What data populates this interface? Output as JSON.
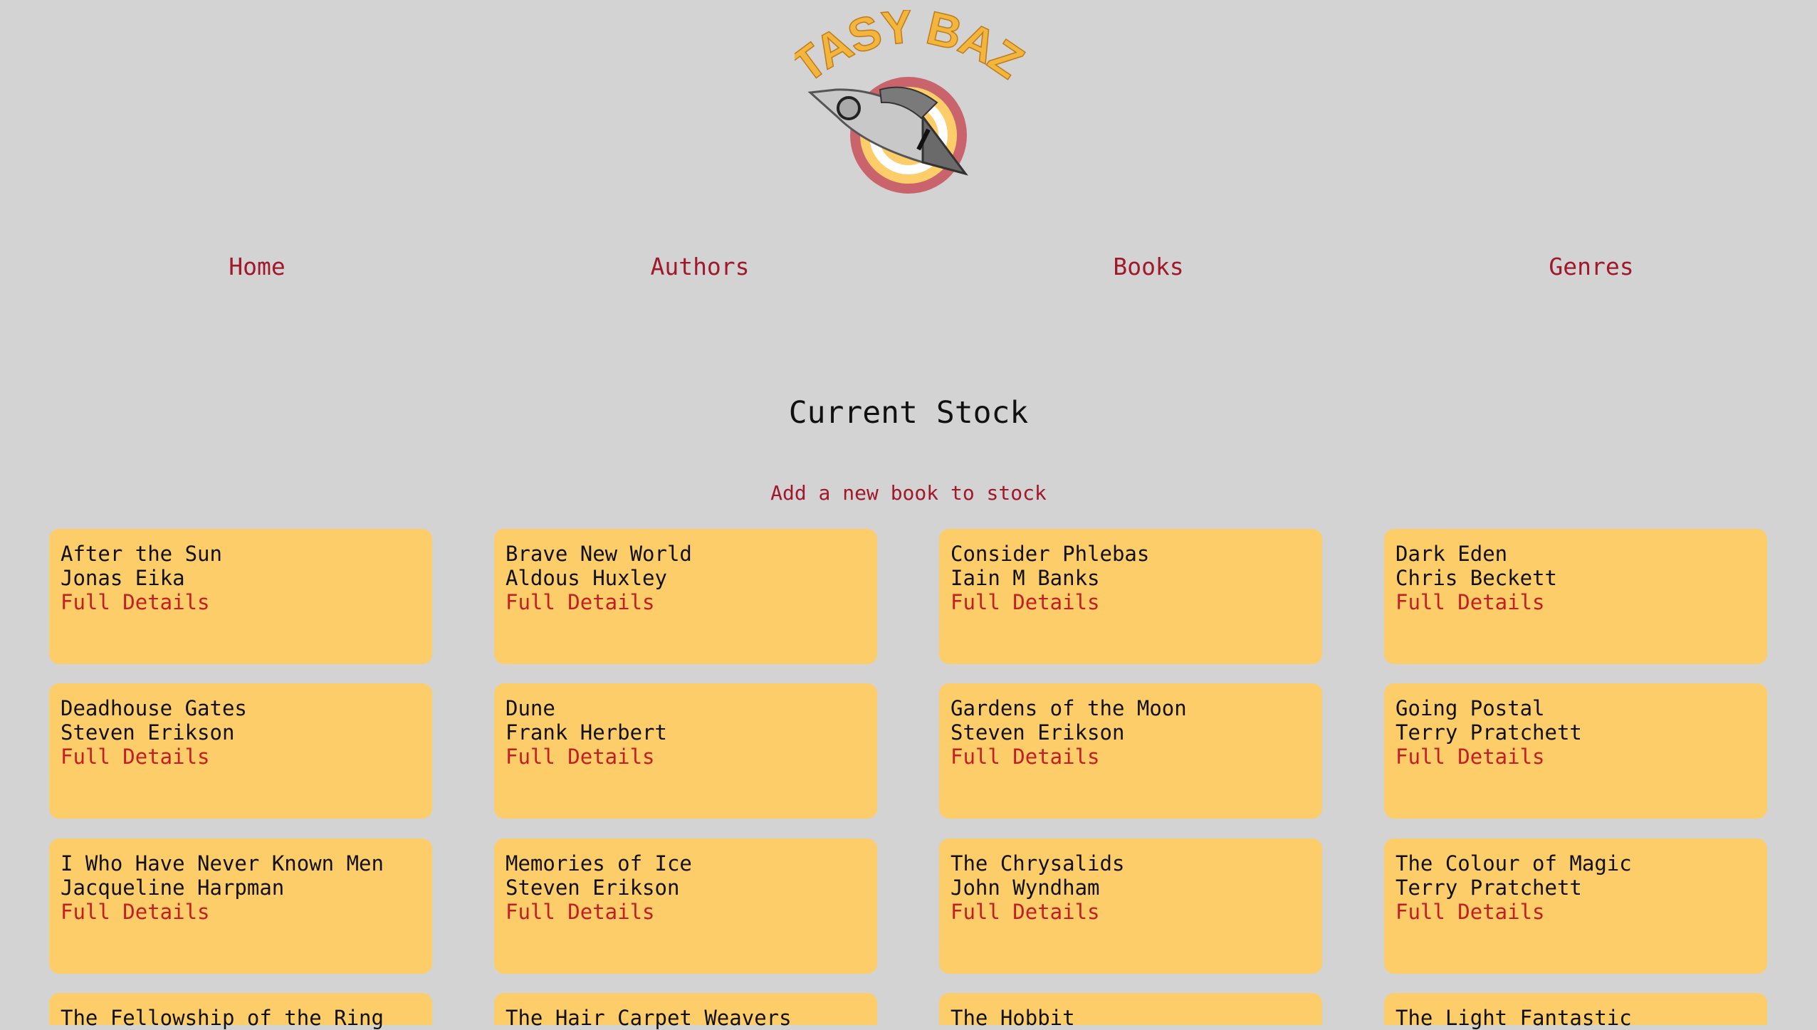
{
  "brand": {
    "logo_text": "FANTASY BAZAAR",
    "colors": {
      "logo_text": "#f2b53d",
      "ring_outer": "#c9646c",
      "ring_middle": "#fdcd69",
      "rocket": "#c8c8c8"
    }
  },
  "nav": {
    "items": [
      {
        "label": "Home"
      },
      {
        "label": "Authors"
      },
      {
        "label": "Books"
      },
      {
        "label": "Genres"
      }
    ]
  },
  "main": {
    "title": "Current Stock",
    "add_link": "Add a new book to stock",
    "books": [
      {
        "title": "After the Sun",
        "author": "Jonas Eika",
        "link": "Full Details"
      },
      {
        "title": "Brave New World",
        "author": "Aldous Huxley",
        "link": "Full Details"
      },
      {
        "title": "Consider Phlebas",
        "author": "Iain M Banks",
        "link": "Full Details"
      },
      {
        "title": "Dark Eden",
        "author": "Chris Beckett",
        "link": "Full Details"
      },
      {
        "title": "Deadhouse Gates",
        "author": "Steven Erikson",
        "link": "Full Details"
      },
      {
        "title": "Dune",
        "author": "Frank Herbert",
        "link": "Full Details"
      },
      {
        "title": "Gardens of the Moon",
        "author": "Steven Erikson",
        "link": "Full Details"
      },
      {
        "title": "Going Postal",
        "author": "Terry Pratchett",
        "link": "Full Details"
      },
      {
        "title": "I Who Have Never Known Men",
        "author": "Jacqueline Harpman",
        "link": "Full Details"
      },
      {
        "title": "Memories of Ice",
        "author": "Steven Erikson",
        "link": "Full Details"
      },
      {
        "title": "The Chrysalids",
        "author": "John Wyndham",
        "link": "Full Details"
      },
      {
        "title": "The Colour of Magic",
        "author": "Terry Pratchett",
        "link": "Full Details"
      },
      {
        "title": "The Fellowship of the Ring",
        "author": "",
        "link": ""
      },
      {
        "title": "The Hair Carpet Weavers",
        "author": "",
        "link": ""
      },
      {
        "title": "The Hobbit",
        "author": "",
        "link": ""
      },
      {
        "title": "The Light Fantastic",
        "author": "",
        "link": ""
      }
    ]
  },
  "colors": {
    "background": "#d3d3d3",
    "link": "#a0182b",
    "details_link": "#c41e24",
    "card": "#fdcd69"
  }
}
